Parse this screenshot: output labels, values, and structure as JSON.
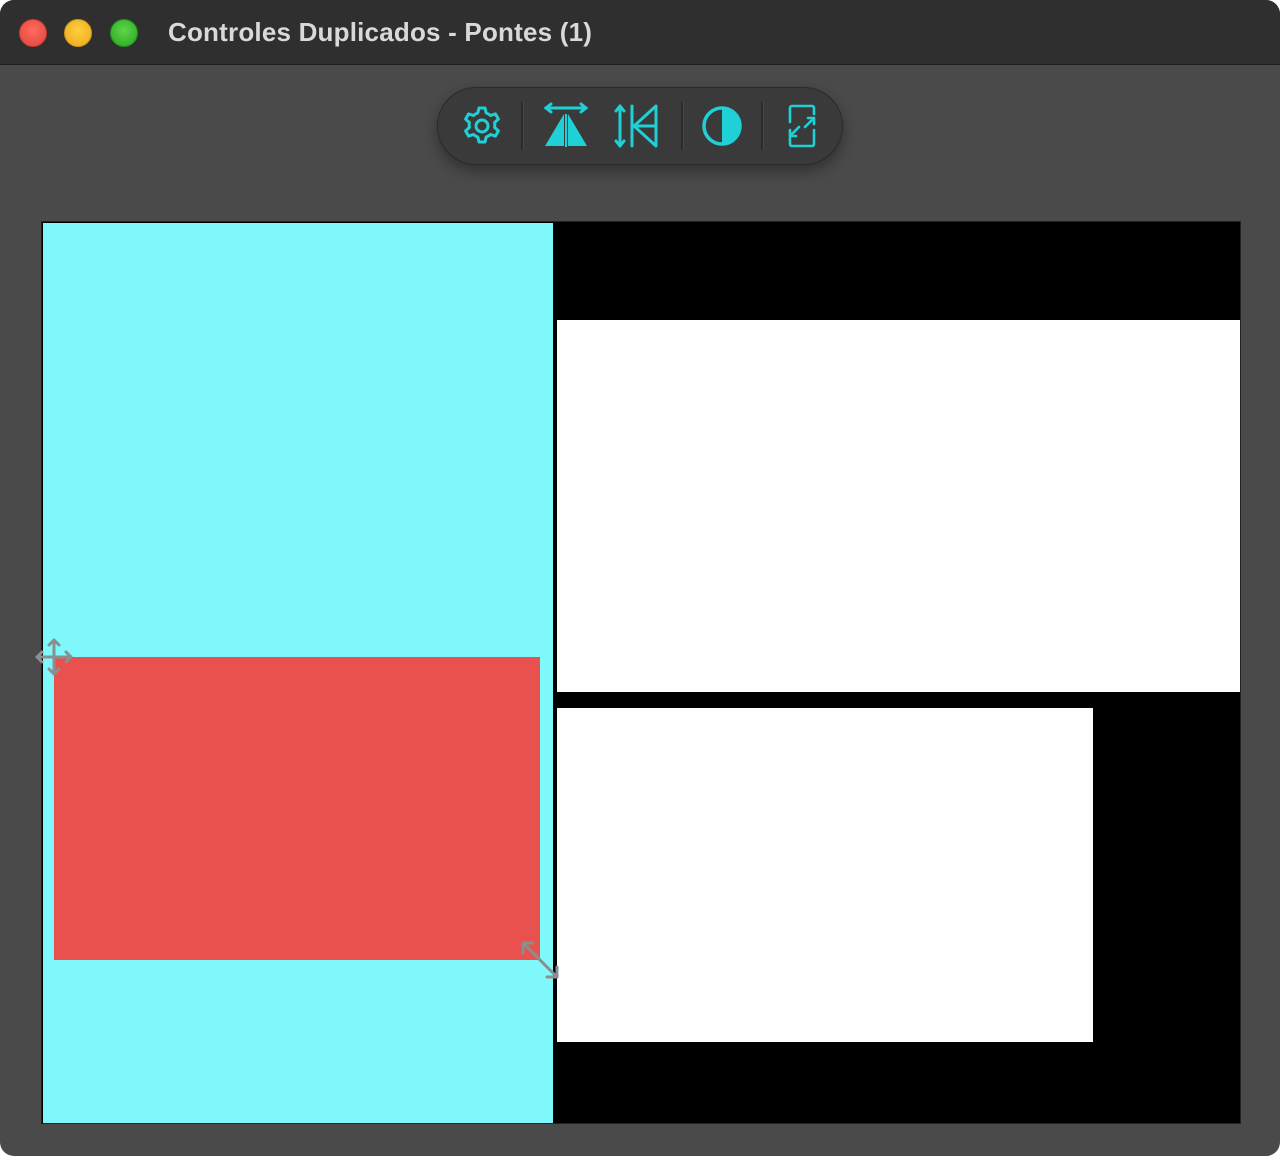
{
  "window": {
    "title": "Controles Duplicados - Pontes (1)"
  },
  "toolbar": {
    "tools": [
      {
        "name": "settings",
        "icon": "gear-icon"
      },
      {
        "name": "align-horizontal",
        "icon": "horizontal-align-icon"
      },
      {
        "name": "align-vertical",
        "icon": "vertical-align-icon"
      },
      {
        "name": "contrast",
        "icon": "contrast-icon"
      },
      {
        "name": "rotate-screen",
        "icon": "rotate-screen-icon"
      }
    ],
    "accent_color": "#1fd1d6"
  },
  "canvas": {
    "background_color": "#000000",
    "panels": [
      {
        "name": "cyan-panel",
        "color": "#7ef8fb"
      },
      {
        "name": "white-panel-top",
        "color": "#fefefe"
      },
      {
        "name": "white-panel-bottom",
        "color": "#fefefe"
      },
      {
        "name": "red-rectangle",
        "color": "#e8514d"
      }
    ],
    "handles": [
      {
        "name": "move-handle",
        "icon": "move-arrows-icon"
      },
      {
        "name": "resize-handle",
        "icon": "diagonal-resize-icon"
      }
    ]
  }
}
